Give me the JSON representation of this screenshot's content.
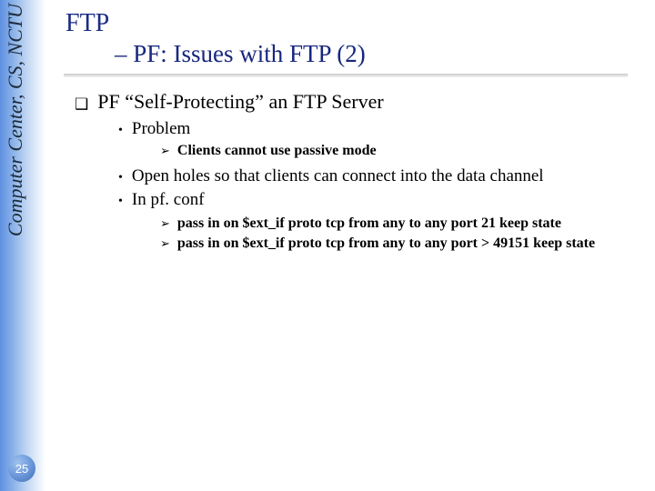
{
  "sidebar": {
    "org_text": "Computer Center, CS, NCTU",
    "page_number": "25"
  },
  "heading": {
    "title": "FTP",
    "subtitle": "– PF: Issues with FTP (2)"
  },
  "bullets": {
    "lvl1_text": "PF “Self-Protecting” an FTP Server",
    "problem_label": "Problem",
    "problem_sub": "Clients cannot use passive mode",
    "open_holes": "Open holes so that clients can connect into the data channel",
    "in_pf_conf": "In pf. conf",
    "rule1": "pass in on $ext_if proto tcp from any to any port 21 keep state",
    "rule2": "pass in on $ext_if proto tcp from any to any port > 49151 keep state"
  },
  "markers": {
    "square": "❑",
    "dot": "•",
    "tri": "➢"
  }
}
